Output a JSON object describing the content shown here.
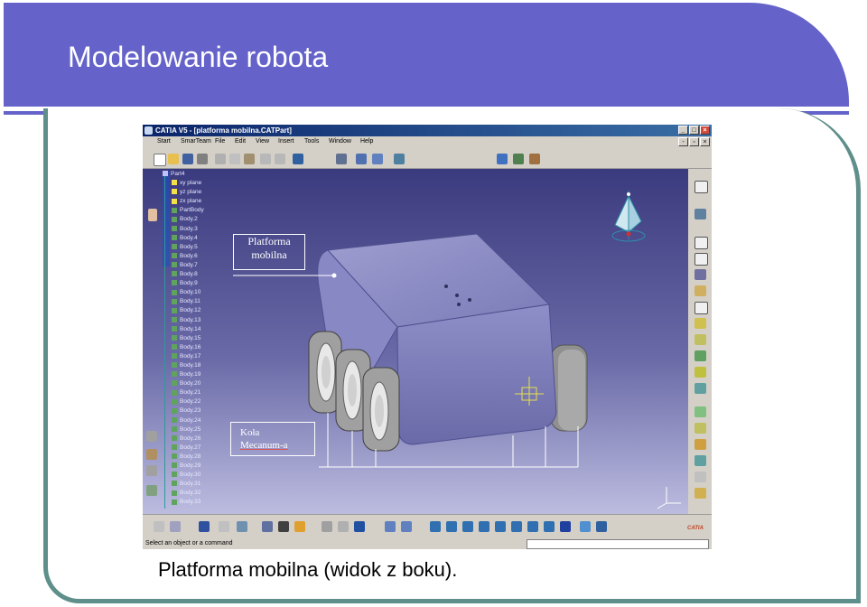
{
  "slide": {
    "title": "Modelowanie robota",
    "caption": "Platforma mobilna (widok z boku)."
  },
  "window": {
    "title": "CATIA V5 - [platforma mobilna.CATPart]",
    "menu": [
      "Start",
      "SmarTeam",
      "File",
      "Edit",
      "View",
      "Insert",
      "Tools",
      "Window",
      "Help"
    ],
    "status_text": "Select an object or a command",
    "logo_text": "CATIA"
  },
  "tree": {
    "root": "Part4",
    "planes": [
      "xy plane",
      "yz plane",
      "zx plane"
    ],
    "partbody": "PartBody",
    "bodies": [
      "Body.2",
      "Body.3",
      "Body.4",
      "Body.5",
      "Body.6",
      "Body.7",
      "Body.8",
      "Body.9",
      "Body.10",
      "Body.11",
      "Body.12",
      "Body.13",
      "Body.14",
      "Body.15",
      "Body.16",
      "Body.17",
      "Body.18",
      "Body.19",
      "Body.20",
      "Body.21",
      "Body.22",
      "Body.23",
      "Body.24",
      "Body.25",
      "Body.26",
      "Body.27",
      "Body.28",
      "Body.29",
      "Body.30",
      "Body.31",
      "Body.32",
      "Body.33"
    ]
  },
  "callouts": {
    "platform_line1": "Platforma",
    "platform_line2": "mobilna",
    "wheels_line1": "Koła",
    "wheels_line2": "Mecanum-a"
  },
  "colors": {
    "title_band": "#6563c9",
    "frame": "#5f8f8a",
    "viewport_top": "#3a3a7e",
    "viewport_bottom": "#bcbce0"
  }
}
